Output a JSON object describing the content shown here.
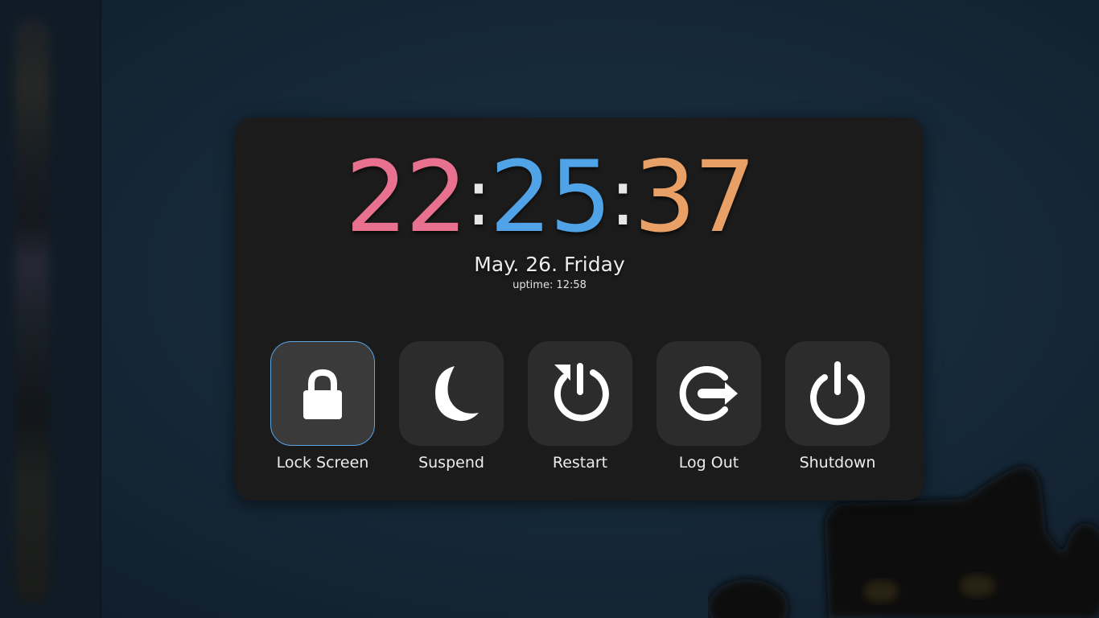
{
  "clock": {
    "hours": "22",
    "minutes": "25",
    "seconds": "37",
    "separator": ":",
    "colors": {
      "hours": "#e7718e",
      "minutes": "#4fa3e6",
      "seconds": "#e9a066"
    }
  },
  "date": "May. 26. Friday",
  "uptime": "uptime: 12:58",
  "actions": [
    {
      "label": "Lock Screen",
      "icon": "lock-icon",
      "focused": true
    },
    {
      "label": "Suspend",
      "icon": "moon-icon",
      "focused": false
    },
    {
      "label": "Restart",
      "icon": "restart-icon",
      "focused": false
    },
    {
      "label": "Log Out",
      "icon": "logout-icon",
      "focused": false
    },
    {
      "label": "Shutdown",
      "icon": "power-icon",
      "focused": false
    }
  ],
  "colors": {
    "panel": "#1b1b1b",
    "tile": "#2c2c2c",
    "focus_border": "#5aa4e6",
    "icon": "#ffffff"
  }
}
